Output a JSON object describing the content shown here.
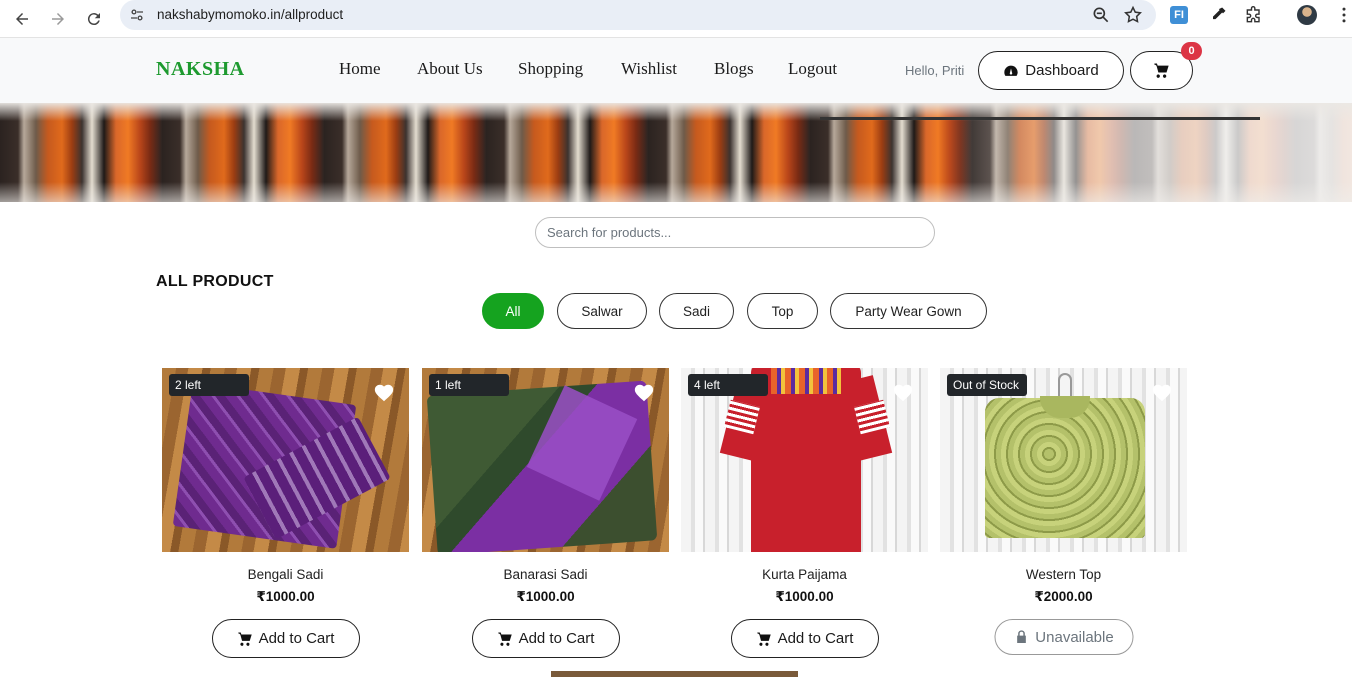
{
  "browser": {
    "url": "nakshabymomoko.in/allproduct",
    "extension_label": "FI"
  },
  "site": {
    "brand": "NAKSHA",
    "nav": [
      "Home",
      "About Us",
      "Shopping",
      "Wishlist",
      "Blogs",
      "Logout"
    ],
    "greeting": "Hello, Priti",
    "dashboard_label": "Dashboard",
    "cart_count": "0",
    "colors": {
      "brand": "#1e9a2f",
      "active_chip": "#15a31f",
      "badge": "#dc3545"
    }
  },
  "search": {
    "placeholder": "Search for products..."
  },
  "section_title": "ALL PRODUCT",
  "filters": [
    "All",
    "Salwar",
    "Sadi",
    "Top",
    "Party Wear Gown"
  ],
  "active_filter": "All",
  "products": [
    {
      "name": "Bengali Sadi",
      "price": "₹1000.00",
      "stock": "2 left",
      "cta": "Add to Cart"
    },
    {
      "name": "Banarasi Sadi",
      "price": "₹1000.00",
      "stock": "1 left",
      "cta": "Add to Cart"
    },
    {
      "name": "Kurta Paijama",
      "price": "₹1000.00",
      "stock": "4 left",
      "cta": "Add to Cart"
    },
    {
      "name": "Western Top",
      "price": "₹2000.00",
      "stock": "Out of Stock",
      "cta": "Unavailable"
    }
  ]
}
